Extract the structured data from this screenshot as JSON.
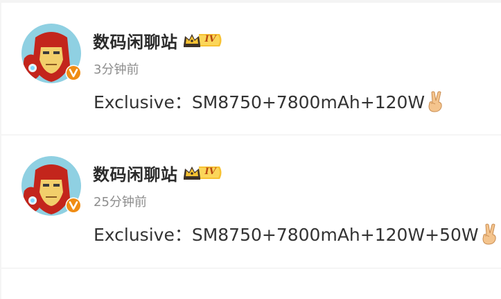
{
  "posts": [
    {
      "author": "数码闲聊站",
      "level_badge": "IV",
      "time": "3分钟前",
      "text": "Exclusive：SM8750+7800mAh+120W",
      "emoji": "victory-hand-emoji",
      "verified_badge": "V"
    },
    {
      "author": "数码闲聊站",
      "level_badge": "IV",
      "time": "25分钟前",
      "text": "Exclusive：SM8750+7800mAh+120W+50W",
      "emoji": "victory-hand-emoji",
      "verified_badge": "V"
    }
  ],
  "colors": {
    "verified_badge": "#f08c14",
    "level_badge": "#f7c232",
    "author": "#2b2b2b",
    "timestamp": "#8d8d8d",
    "body_text": "#333333"
  }
}
